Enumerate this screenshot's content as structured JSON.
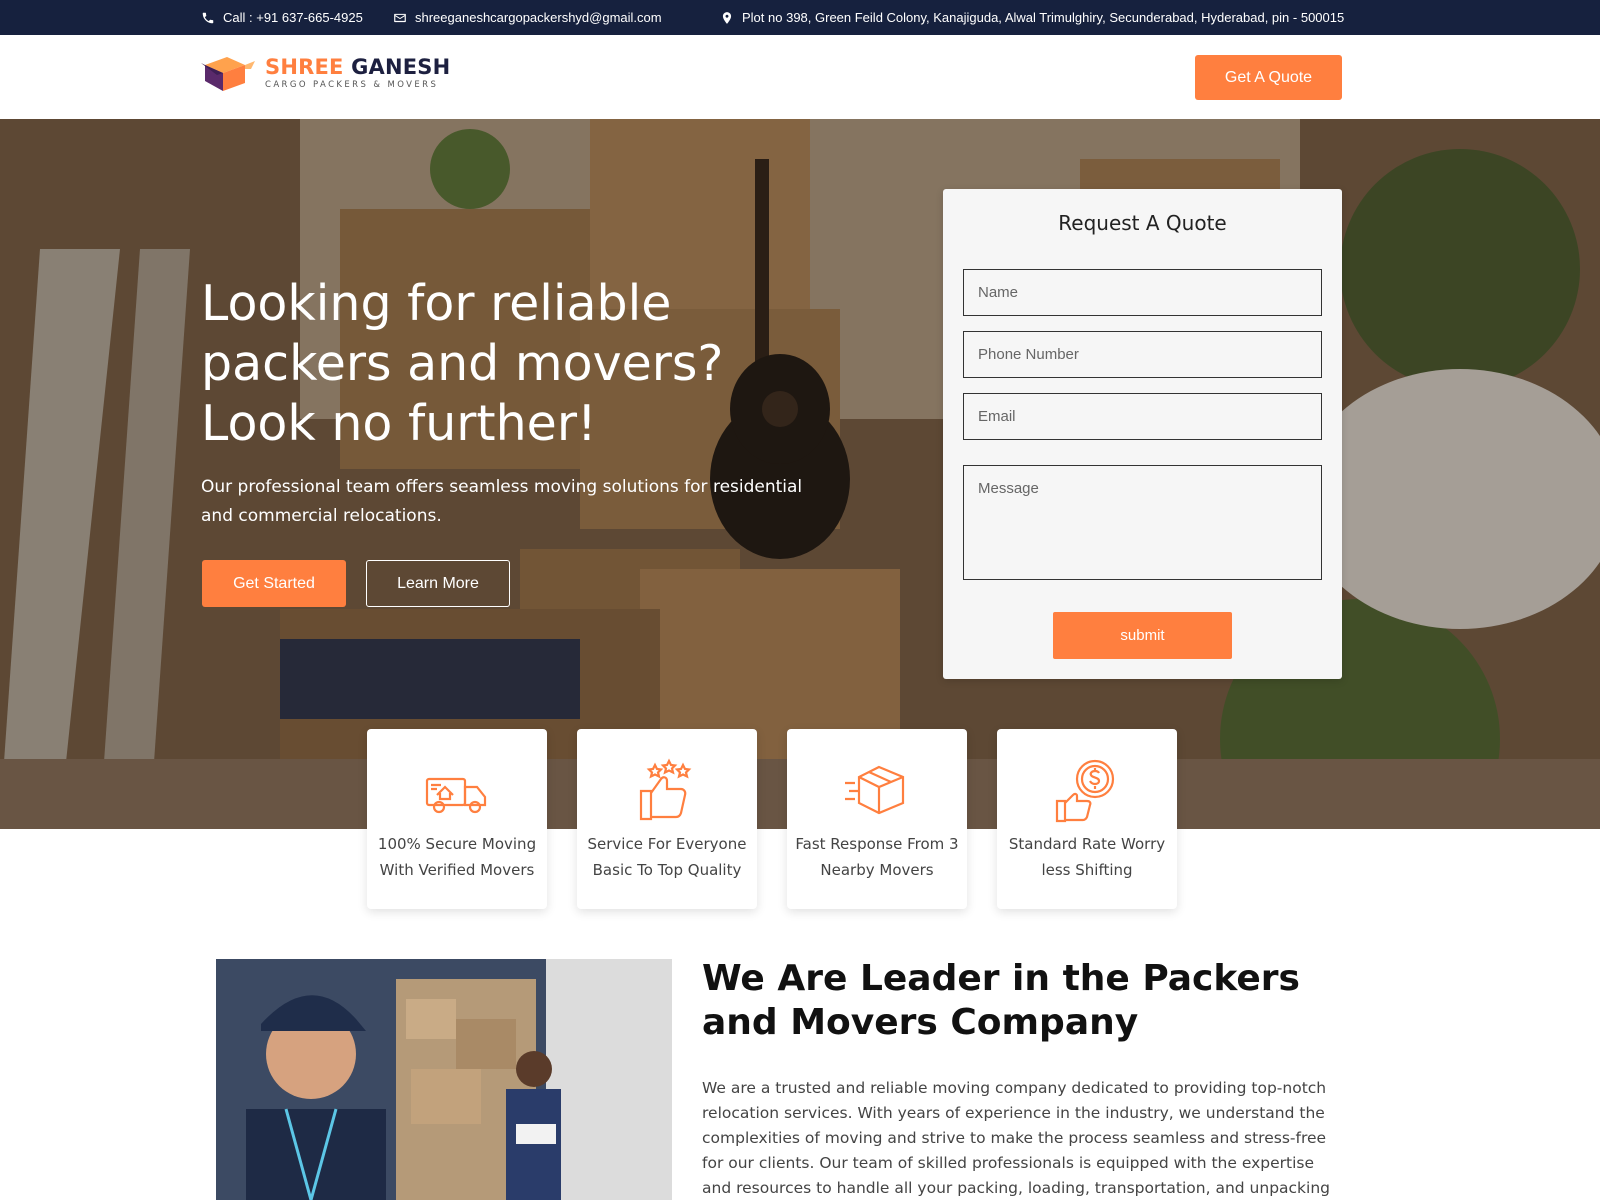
{
  "topbar": {
    "call": "Call : +91 637-665-4925",
    "email": "shreeganeshcargopackershyd@gmail.com",
    "address": "Plot no 398, Green Feild Colony, Kanajiguda, Alwal Trimulghiry, Secunderabad, Hyderabad, pin - 500015"
  },
  "header": {
    "logo_word1": "SHREE",
    "logo_word2": "GANESH",
    "logo_sub": "CARGO PACKERS & MOVERS",
    "quote_button": "Get A Quote"
  },
  "hero": {
    "title": "Looking for reliable packers and movers? Look no further!",
    "description": "Our professional team offers seamless moving solutions for residential and commercial relocations.",
    "primary_button": "Get Started",
    "secondary_button": "Learn More"
  },
  "quote_form": {
    "title": "Request A Quote",
    "name_placeholder": "Name",
    "phone_placeholder": "Phone Number",
    "email_placeholder": "Email",
    "message_placeholder": "Message",
    "submit_label": "submit"
  },
  "features": [
    {
      "icon": "moving-truck-icon",
      "text": "100% Secure Moving With Verified Movers"
    },
    {
      "icon": "thumbs-up-stars-icon",
      "text": "Service For Everyone Basic To Top Quality"
    },
    {
      "icon": "fast-box-icon",
      "text": "Fast Response From 3 Nearby Movers"
    },
    {
      "icon": "dollar-thumbs-up-icon",
      "text": "Standard Rate Worry less Shifting"
    }
  ],
  "about": {
    "title": "We Are Leader in the Packers and Movers Company",
    "text": "We are a trusted and reliable moving company dedicated to providing top-notch relocation services. With years of experience in the industry, we understand the complexities of moving and strive to make the process seamless and stress-free for our clients. Our team of skilled professionals is equipped with the expertise and resources to handle all your packing, loading, transportation, and unpacking needs."
  },
  "colors": {
    "accent": "#ff7f3f",
    "topbar": "#16213e",
    "logo_dark": "#1d2040"
  }
}
